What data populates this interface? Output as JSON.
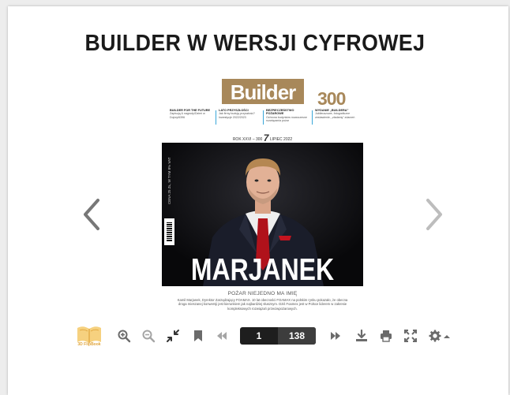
{
  "page": {
    "title": "BUILDER W WERSJI CYFROWEJ"
  },
  "magazine": {
    "logo": "Builder",
    "anniversary": "300",
    "teasers": [
      {
        "head": "BUILDER FOR THE FUTURE",
        "text": "Zapisują & nagrody/Dzień w Dojrzy/6396"
      },
      {
        "head": "LATO PRZYSZŁOŚCI",
        "text": "Jak firmy budują przyszłość? Inwestycje 2022/2023"
      },
      {
        "head": "BEZPIECZEŃSTWO POŻAROWE",
        "text": "Ochrona budynków nowoczesne rozwiązania pożar"
      },
      {
        "head": "WYDANIE „BUILDERA”",
        "text": "Jubileuszowe, fotograficzne zestawienie, „zładamy” zdarzeń"
      }
    ],
    "issue_prefix": "ROK XXVI – 300",
    "issue_number": "7",
    "issue_suffix": "LIPIEC 2022",
    "side_text": "CENA 25 ZŁ, W TYM 8% VAT",
    "headline": "MARJANEK",
    "caption_title": "POŻAR NIEJEDNO MA IMIĘ",
    "caption": "Kamil Marjanek, Dyrektor Zarządzający FOAMAX. 10 lat obecności FOAMAX na polskim rynku pokazało, że obecna droga mieszanej konwersji jest kierunkiem jak najbardziej słusznym. Dziś Foamex jest w Polsce liderem w zakresie kompleksowych rozwiązań przeciwpożarowych."
  },
  "toolbar": {
    "brand": "3D FlipBook",
    "current_page": "1",
    "total_pages": "138",
    "icons": [
      "zoom-in-icon",
      "zoom-out-icon",
      "fullscreen-exit-icon",
      "bookmark-icon",
      "first-page-icon",
      "last-page-icon",
      "download-icon",
      "print-icon",
      "fullscreen-icon",
      "settings-icon"
    ]
  },
  "colors": {
    "brand_gold": "#a8885a",
    "flipbook_orange": "#e0a43a",
    "pager_dark": "#1e1e1e",
    "icon_grey": "#6b6b6b"
  }
}
